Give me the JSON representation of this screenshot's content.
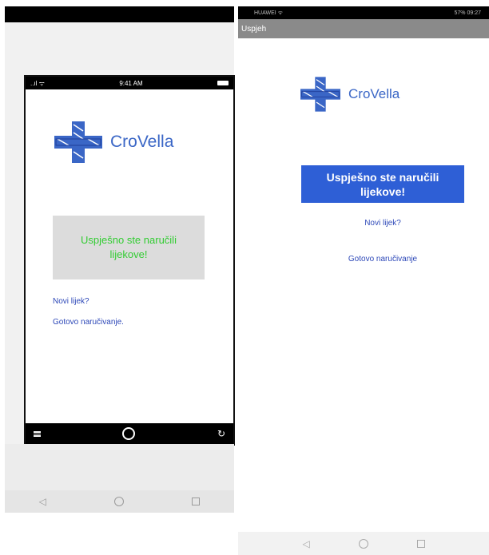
{
  "left": {
    "phone_status": {
      "signal": "..ıl ᯤ",
      "time": "9:41 AM"
    },
    "brand": "CroVella",
    "message": "Uspješno ste naručili lijekove!",
    "links": [
      "Novi lijek?",
      "Gotovo naručivanje."
    ],
    "bottom_icons": [
      "menu-icon",
      "home-circle-icon",
      "refresh-icon"
    ],
    "colors": {
      "brand": "#3a66c6",
      "message_text": "#33cc33",
      "message_bg": "#dcdcdc",
      "link": "#2d48b8"
    }
  },
  "right": {
    "status_bar": {
      "left": "HUAWEI ᯤ",
      "right": "57% 09:27"
    },
    "app_title": "Uspjeh",
    "brand": "CroVella",
    "message": "Uspješno ste naručili lijekove!",
    "links": [
      "Novi lijek?",
      "Gotovo naručivanje"
    ],
    "colors": {
      "brand": "#3a66c6",
      "message_bg": "#2e5fd6",
      "link": "#2d48b8",
      "app_bar": "#8a8a8a"
    }
  },
  "system_nav": {
    "icons": [
      "back-icon",
      "home-icon",
      "recent-apps-icon"
    ],
    "back": "◁"
  }
}
